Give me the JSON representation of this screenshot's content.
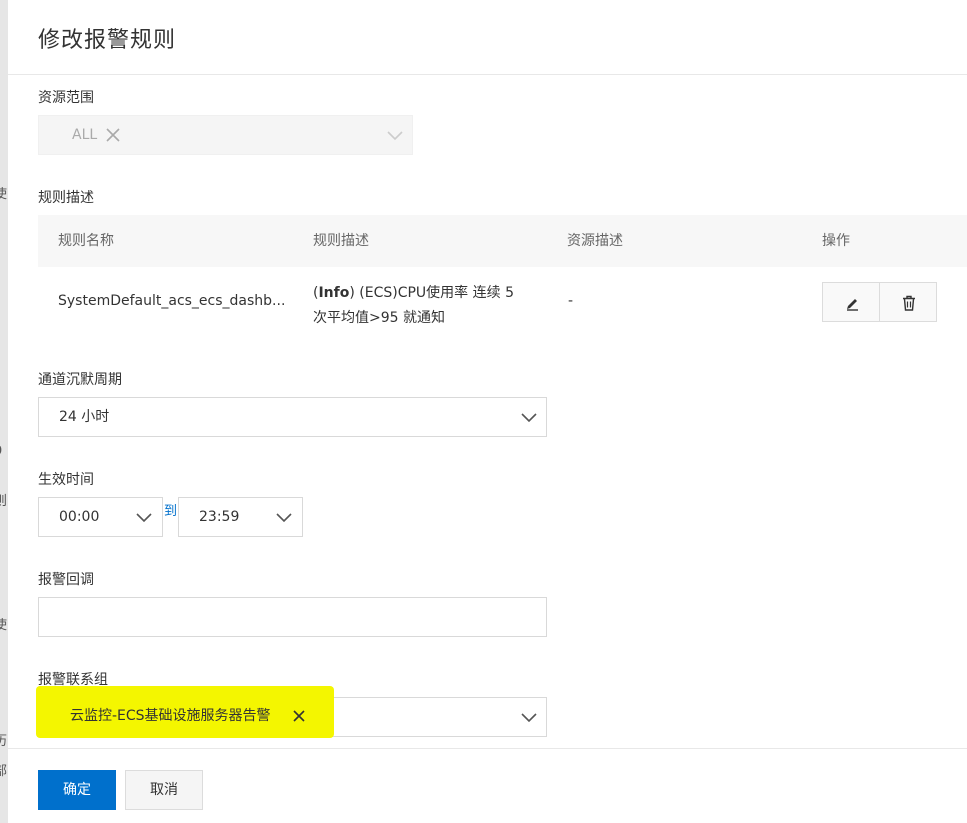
{
  "background_fragments": [
    "使",
    "9",
    "则",
    "使",
    "历",
    "部"
  ],
  "title": "修改报警规则",
  "resource_scope": {
    "label": "资源范围",
    "tag": "ALL"
  },
  "rules": {
    "label": "规则描述",
    "columns": [
      "规则名称",
      "规则描述",
      "资源描述",
      "操作"
    ],
    "rows": [
      {
        "name": "SystemDefault_acs_ecs_dashb...",
        "level": "Info",
        "desc_line1_rest": " (ECS)CPU使用率 连续 5",
        "desc_line2": "次平均值>95 就通知",
        "resource": "-"
      }
    ]
  },
  "silence": {
    "label": "通道沉默周期",
    "value": "24 小时"
  },
  "effective_time": {
    "label": "生效时间",
    "start": "00:00",
    "separator": "到",
    "end": "23:59"
  },
  "callback": {
    "label": "报警回调",
    "value": ""
  },
  "contact_group": {
    "label": "报警联系组",
    "tag": "云监控-ECS基础设施服务器告警"
  },
  "footer": {
    "confirm": "确定",
    "cancel": "取消"
  },
  "colors": {
    "primary": "#0070cc",
    "highlight": "#f4f600",
    "link": "#0070cc"
  }
}
